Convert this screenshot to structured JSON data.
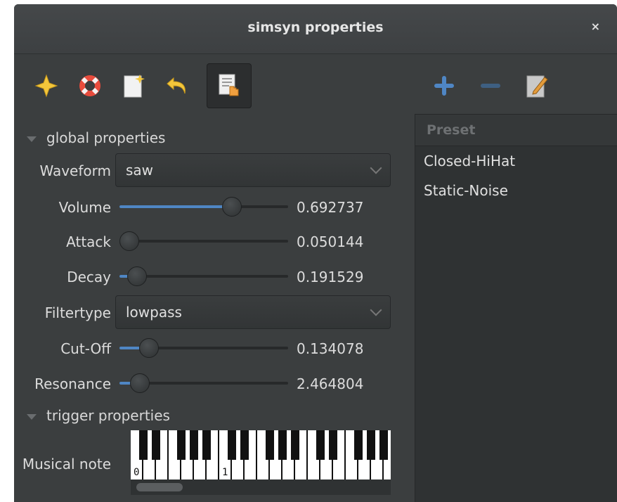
{
  "window": {
    "title": "simsyn properties",
    "close_glyph": "×"
  },
  "toolbar": {
    "icons": [
      "star-icon",
      "help-lifebuoy-icon",
      "new-document-icon",
      "undo-icon",
      "paste-hand-icon"
    ],
    "active": "paste-hand-icon"
  },
  "preset_toolbar": {
    "icons": [
      "plus-icon",
      "minus-icon",
      "edit-pencil-icon"
    ]
  },
  "global": {
    "section_label": "global properties",
    "waveform": {
      "label": "Waveform",
      "value": "saw"
    },
    "volume": {
      "label": "Volume",
      "value": "0.692737",
      "fraction": 0.69
    },
    "attack": {
      "label": "Attack",
      "value": "0.050144",
      "fraction": 0.0
    },
    "decay": {
      "label": "Decay",
      "value": "0.191529",
      "fraction": 0.05
    },
    "filtertype": {
      "label": "Filtertype",
      "value": "lowpass"
    },
    "cutoff": {
      "label": "Cut-Off",
      "value": "0.134078",
      "fraction": 0.13
    },
    "resonance": {
      "label": "Resonance",
      "value": "2.464804",
      "fraction": 0.07
    }
  },
  "trigger": {
    "section_label": "trigger properties",
    "musical_note": {
      "label": "Musical note",
      "octave_labels": [
        "0",
        "1"
      ]
    }
  },
  "presets": {
    "header": "Preset",
    "items": [
      "Closed-HiHat",
      "Static-Noise"
    ]
  },
  "colors": {
    "accent": "#4f86c4",
    "background": "#3b3e3f"
  }
}
